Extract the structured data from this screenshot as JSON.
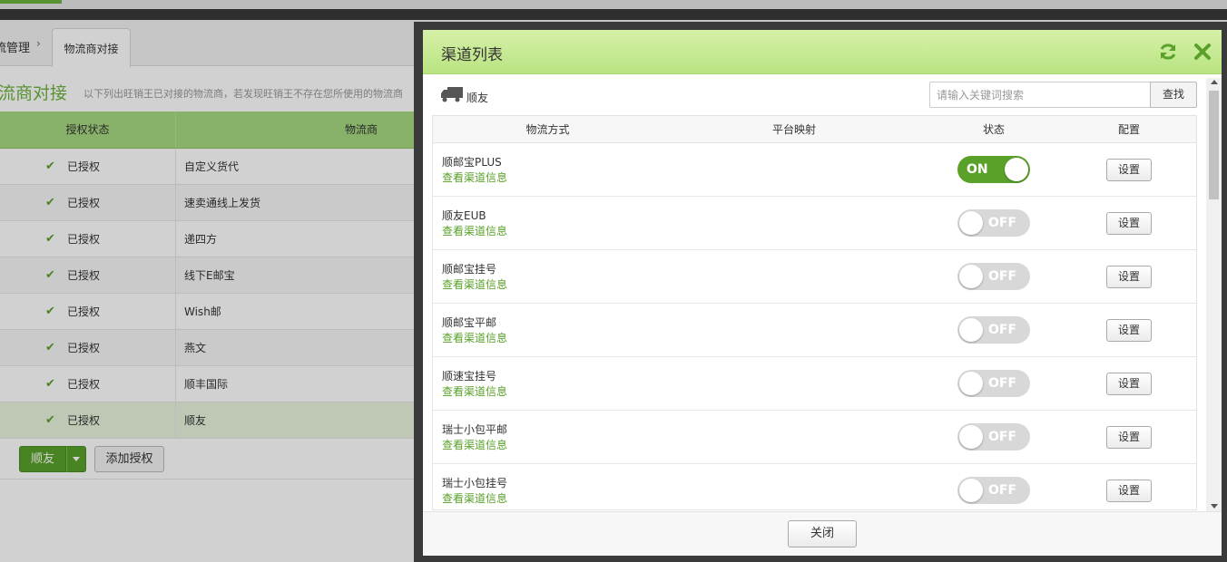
{
  "breadcrumb": {
    "parent": "流管理",
    "separator": "›",
    "current_tab": "物流商对接"
  },
  "page": {
    "title": "流商对接",
    "description": "以下列出旺销王已对接的物流商，若发现旺销王不存在您所使用的物流商"
  },
  "bg_table": {
    "headers": [
      "授权状态",
      "物流商"
    ],
    "rows": [
      {
        "status": "已授权",
        "name": "自定义货代"
      },
      {
        "status": "已授权",
        "name": "速卖通线上发货"
      },
      {
        "status": "已授权",
        "name": "递四方"
      },
      {
        "status": "已授权",
        "name": "线下E邮宝"
      },
      {
        "status": "已授权",
        "name": "Wish邮"
      },
      {
        "status": "已授权",
        "name": "燕文"
      },
      {
        "status": "已授权",
        "name": "顺丰国际"
      },
      {
        "status": "已授权",
        "name": "顺友"
      }
    ],
    "split_button_label": "顺友",
    "add_button_label": "添加授权"
  },
  "modal": {
    "title": "渠道列表",
    "carrier_name": "顺友",
    "search_placeholder": "请输入关键词搜索",
    "search_button": "查找",
    "columns": [
      "物流方式",
      "平台映射",
      "状态",
      "配置"
    ],
    "rows": [
      {
        "name": "顺邮宝PLUS",
        "link": "查看渠道信息",
        "toggle": "ON",
        "on": true,
        "config": "设置"
      },
      {
        "name": "顺友EUB",
        "link": "查看渠道信息",
        "toggle": "OFF",
        "on": false,
        "config": "设置"
      },
      {
        "name": "顺邮宝挂号",
        "link": "查看渠道信息",
        "toggle": "OFF",
        "on": false,
        "config": "设置"
      },
      {
        "name": "顺邮宝平邮",
        "link": "查看渠道信息",
        "toggle": "OFF",
        "on": false,
        "config": "设置"
      },
      {
        "name": "顺速宝挂号",
        "link": "查看渠道信息",
        "toggle": "OFF",
        "on": false,
        "config": "设置"
      },
      {
        "name": "瑞士小包平邮",
        "link": "查看渠道信息",
        "toggle": "OFF",
        "on": false,
        "config": "设置"
      },
      {
        "name": "瑞士小包挂号",
        "link": "查看渠道信息",
        "toggle": "OFF",
        "on": false,
        "config": "设置"
      }
    ],
    "close_button": "关闭",
    "icons": {
      "refresh": "refresh-icon",
      "close": "close-icon",
      "carrier": "truck-icon"
    }
  },
  "colors": {
    "accent": "#5aa12a",
    "header_green": "#b9e482",
    "table_header_green": "#a6d880"
  }
}
